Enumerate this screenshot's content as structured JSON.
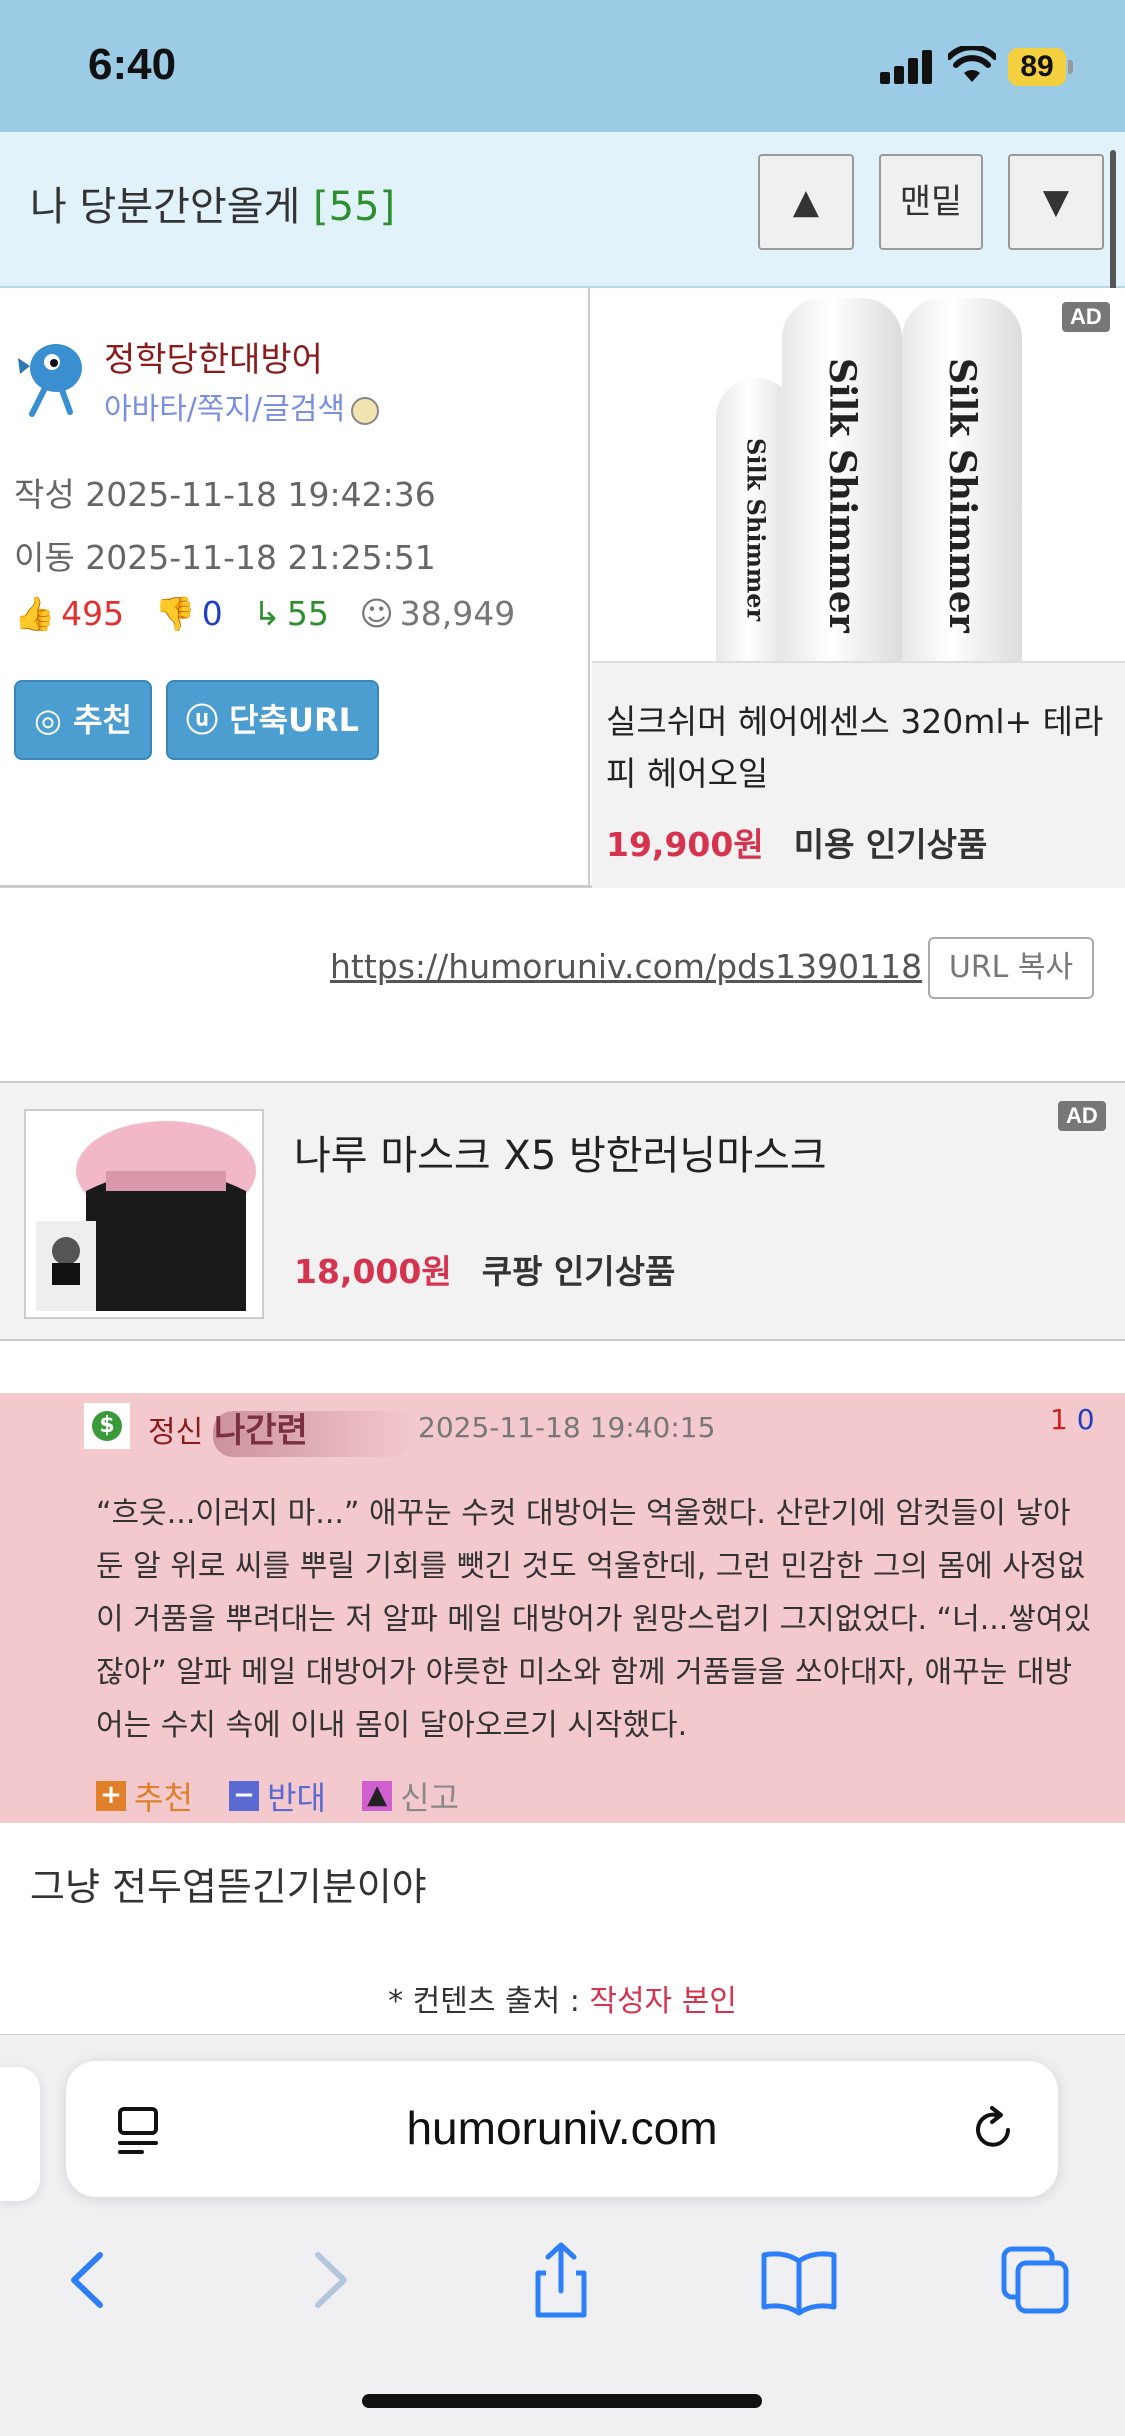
{
  "status": {
    "time": "6:40",
    "battery": "89"
  },
  "header": {
    "title": "나 당분간안올게",
    "count": "[55]",
    "btn_up": "▲",
    "btn_bottom": "맨밑",
    "btn_down": "▼"
  },
  "post": {
    "author": "정학당한대방어",
    "author_links": "아바타/쪽지/글검색",
    "written_label": "작성",
    "written": "2025-11-18 19:42:36",
    "moved_label": "이동",
    "moved": "2025-11-18 21:25:51",
    "likes": "495",
    "dislikes": "0",
    "comments": "55",
    "views": "38,949",
    "recommend_btn": "추천",
    "shorturl_btn": "단축URL",
    "permalink": "https://humoruniv.com/pds1390118",
    "copy_btn": "URL 복사",
    "body": "그냥 전두엽뜯긴기분이야",
    "source_label": "* 컨텐츠 출처 :",
    "source_value": "작성자 본인"
  },
  "ad1": {
    "tag": "AD",
    "bottle_text": "Silk Shimmer",
    "title": "실크쉬머 헤어에센스 320ml+ 테라피 헤어오일",
    "price": "19,900원",
    "category": "미용 인기상품"
  },
  "ad2": {
    "tag": "AD",
    "title": "나루 마스크 X5 방한러닝마스크",
    "price": "18,000원",
    "category": "쿠팡 인기상품"
  },
  "comment": {
    "badge_icon": "dollar-icon",
    "level": "정신",
    "name": "나간련",
    "date": "2025-11-18 19:40:15",
    "up": "1",
    "down": "0",
    "text": "“흐읏...이러지 마...” 애꾸눈 수컷 대방어는 억울했다. 산란기에 암컷들이 낳아둔 알 위로 씨를 뿌릴 기회를 뺏긴 것도 억울한데, 그런 민감한 그의 몸에 사정없이 거품을 뿌려대는 저 알파 메일 대방어가 원망스럽기 그지없었다. “너...쌓여있잖아” 알파 메일 대방어가 야릇한 미소와 함께 거품들을 쏘아대자, 애꾸눈 대방어는 수치 속에 이내 몸이 달아오르기 시작했다.",
    "recommend": "추천",
    "oppose": "반대",
    "report": "신고"
  },
  "browser": {
    "url": "humoruniv.com"
  },
  "colors": {
    "header_bg": "#9ccbe6",
    "comment_bg": "#f4c9cd",
    "price": "#d6334f",
    "button": "#4c9dd0"
  }
}
